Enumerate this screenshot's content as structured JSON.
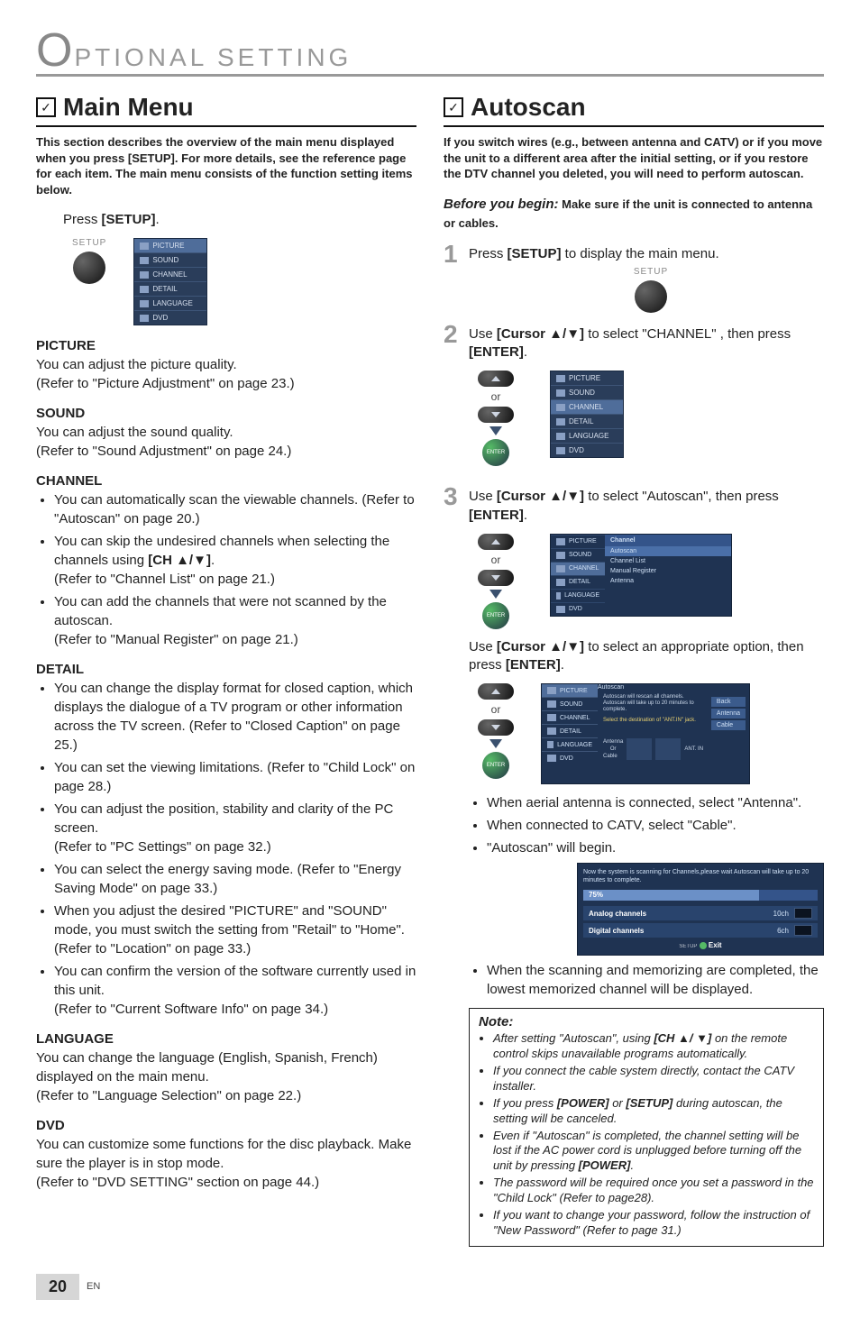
{
  "chapter": {
    "bigletter": "O",
    "rest": "PTIONAL  SETTING"
  },
  "checkmark": "✓",
  "left": {
    "title": "Main Menu",
    "intro": "This section describes the overview of the main menu displayed when you press [SETUP]. For more details, see the reference page for each item. The main menu consists of the function setting items below.",
    "press_setup_pre": "Press ",
    "press_setup_bold": "[SETUP]",
    "press_setup_post": ".",
    "setup_label": "SETUP",
    "osd_items": [
      "PICTURE",
      "SOUND",
      "CHANNEL",
      "DETAIL",
      "LANGUAGE",
      "DVD"
    ],
    "picture": {
      "h": "PICTURE",
      "l1": "You can adjust the picture quality.",
      "l2": "(Refer to \"Picture Adjustment\" on page 23.)"
    },
    "sound": {
      "h": "SOUND",
      "l1": "You can adjust the sound quality.",
      "l2": "(Refer to \"Sound Adjustment\" on page 24.)"
    },
    "channel": {
      "h": "CHANNEL",
      "b1a": "You can automatically scan the viewable channels. (Refer to \"Autoscan\" on page 20.)",
      "b2a": "You can skip the undesired channels when selecting the channels using ",
      "b2bold": "[CH ▲/▼]",
      "b2b": ".",
      "b2c": "(Refer to \"Channel List\" on page 21.)",
      "b3a": "You can add the channels that were not scanned by the autoscan.",
      "b3b": "(Refer to \"Manual Register\" on page 21.)"
    },
    "detail": {
      "h": "DETAIL",
      "b1": "You can change the display format for closed caption, which displays the dialogue of a TV program or other information across the TV screen. (Refer to \"Closed Caption\" on page 25.)",
      "b2": "You can set the viewing limitations. (Refer to \"Child Lock\" on page 28.)",
      "b3": "You can adjust the position, stability and clarity of the PC screen.",
      "b3b": "(Refer to \"PC Settings\" on page 32.)",
      "b4": "You can select the energy saving mode. (Refer to \"Energy Saving Mode\" on page 33.)",
      "b5": "When you adjust the desired \"PICTURE\" and \"SOUND\" mode, you must switch the setting from \"Retail\" to \"Home\". (Refer to \"Location\" on page 33.)",
      "b6": "You can confirm the version of the software currently used in this unit.",
      "b6b": "(Refer to \"Current Software Info\" on page 34.)"
    },
    "language": {
      "h": "LANGUAGE",
      "l1": "You can change the language (English, Spanish, French) displayed on the main menu.",
      "l2": "(Refer to \"Language Selection\" on page 22.)"
    },
    "dvd": {
      "h": "DVD",
      "l1": "You can customize some functions for the disc playback. Make sure the player is in stop mode.",
      "l2": "(Refer to \"DVD SETTING\" section on page 44.)"
    }
  },
  "right": {
    "title": "Autoscan",
    "intro": "If you switch wires (e.g., between antenna and CATV) or if you move the unit to a different area after the initial setting, or if you restore the DTV channel you deleted, you will need to perform autoscan.",
    "before_label": "Before you begin:",
    "before_text": " Make sure if the unit is connected to antenna or cables.",
    "step1_pre": "Press ",
    "step1_bold": "[SETUP]",
    "step1_post": " to display the main menu.",
    "setup_label": "SETUP",
    "step2_pre": "Use ",
    "step2_bold": "[Cursor ▲/▼]",
    "step2_mid": " to select \"CHANNEL\" , then press ",
    "step2_bold2": "[ENTER]",
    "step2_post": ".",
    "or": "or",
    "enter": "ENTER",
    "osd_side": [
      "PICTURE",
      "SOUND",
      "CHANNEL",
      "DETAIL",
      "LANGUAGE",
      "DVD"
    ],
    "step3_pre": "Use ",
    "step3_bold": "[Cursor ▲/▼]",
    "step3_mid": " to select \"Autoscan\", then press ",
    "step3_bold2": "[ENTER]",
    "step3_post": ".",
    "osd_channel_header": "Channel",
    "osd_channel_items": [
      "Autoscan",
      "Channel List",
      "Manual Register",
      "Antenna"
    ],
    "step3b_pre": "Use ",
    "step3b_bold": "[Cursor ▲/▼]",
    "step3b_mid": " to select an appropriate option, then press ",
    "step3b_bold2": "[ENTER]",
    "step3b_post": ".",
    "osd_autoscan_header": "Autoscan",
    "osd_autoscan_desc1": "Autoscan will rescan all channels. Autoscan will take up to 20 minutes to complete.",
    "osd_autoscan_desc2": "Select the destination of \"ANT.IN\" jack.",
    "osd_autoscan_btns": [
      "Back",
      "Antenna",
      "Cable"
    ],
    "osd_autoscan_labels": {
      "antenna": "Antenna",
      "cable": "Cable",
      "or": "Or",
      "antin": "ANT. IN"
    },
    "bullets_after": [
      "When aerial antenna is connected, select \"Antenna\".",
      "When connected to CATV, select \"Cable\".",
      "\"Autoscan\" will begin."
    ],
    "progress": {
      "msg": "Now the system is scanning for Channels,please wait Autoscan will take up to 20 minutes to complete.",
      "pct": "75%",
      "analog_label": "Analog channels",
      "analog_val": "10ch",
      "digital_label": "Digital channels",
      "digital_val": "6ch",
      "exit_pre": "SETUP",
      "exit": "Exit"
    },
    "after_scan": "When the scanning and memorizing are completed, the lowest memorized channel will be displayed.",
    "note": {
      "h": "Note:",
      "items": [
        {
          "pre": "After setting \"Autoscan\", using ",
          "bold": "[CH ▲/ ▼]",
          "post": " on the remote control skips unavailable programs automatically."
        },
        {
          "pre": "If you connect the cable system directly, contact the CATV installer.",
          "bold": "",
          "post": ""
        },
        {
          "pre": "If you press ",
          "bold": "[POWER]",
          "mid": " or ",
          "bold2": "[SETUP]",
          "post": " during autoscan, the setting will be canceled."
        },
        {
          "pre": "Even if \"Autoscan\" is completed, the channel setting will be lost if the AC power cord is unplugged before turning off the unit by pressing ",
          "bold": "[POWER]",
          "post": "."
        },
        {
          "pre": "The password will be required once you set a password in the \"Child Lock\" (Refer to page28).",
          "bold": "",
          "post": ""
        },
        {
          "pre": "If you want to change your password, follow the instruction of \"New Password\" (Refer to page 31.)",
          "bold": "",
          "post": ""
        }
      ]
    }
  },
  "footer": {
    "page": "20",
    "lang": "EN"
  }
}
